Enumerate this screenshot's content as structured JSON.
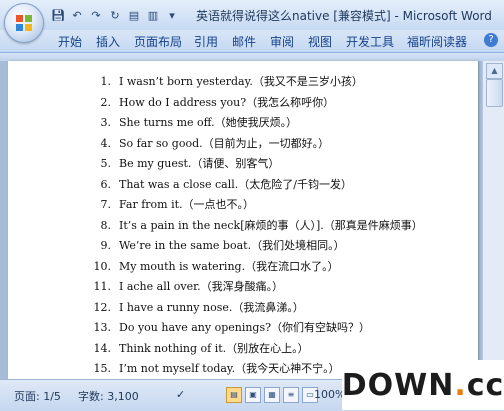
{
  "titlebar": {
    "title": "英语就得说得这么native [兼容模式] - Microsoft Word",
    "quick_access": [
      "save-icon",
      "undo-icon",
      "redo-icon",
      "repeat-icon",
      "open-icon",
      "print-icon"
    ]
  },
  "tabs": [
    "开始",
    "插入",
    "页面布局",
    "引用",
    "邮件",
    "审阅",
    "视图",
    "开发工具",
    "福昕阅读器"
  ],
  "document": {
    "lines": [
      {
        "num": "1.",
        "text": "I wasn’t born yesterday.（我又不是三岁小孩）"
      },
      {
        "num": "2.",
        "text": "How do I address you?（我怎么称呼你）"
      },
      {
        "num": "3.",
        "text": "She turns me off.（她使我厌烦。）"
      },
      {
        "num": "4.",
        "text": "So far so good.（目前为止，一切都好。）"
      },
      {
        "num": "5.",
        "text": "Be my guest.（请便、别客气）"
      },
      {
        "num": "6.",
        "text": "That was a close call.（太危险了/千钧一发）"
      },
      {
        "num": "7.",
        "text": "Far from it.（一点也不。）"
      },
      {
        "num": "8.",
        "text": "It’s a pain in the neck[麻烦的事（人）].（那真是件麻烦事）"
      },
      {
        "num": "9.",
        "text": "We’re in the same boat.（我们处境相同。）"
      },
      {
        "num": "10.",
        "text": "My mouth is watering.（我在流口水了。）"
      },
      {
        "num": "11.",
        "text": "I ache all over.（我浑身酸痛。）"
      },
      {
        "num": "12.",
        "text": "I have a runny nose.（我流鼻涕。）"
      },
      {
        "num": "13.",
        "text": "Do you have any openings?（你们有空缺吗？）"
      },
      {
        "num": "14.",
        "text": "Think nothing of it.（别放在心上。）"
      },
      {
        "num": "15.",
        "text": "I’m not myself today.（我今天心神不宁。）"
      }
    ]
  },
  "status": {
    "page": "页面: 1/5",
    "words": "字数: 3,100",
    "zoom": "100%"
  },
  "watermark": {
    "text": "DOWN",
    "dot": ".",
    "suffix": "cc"
  }
}
